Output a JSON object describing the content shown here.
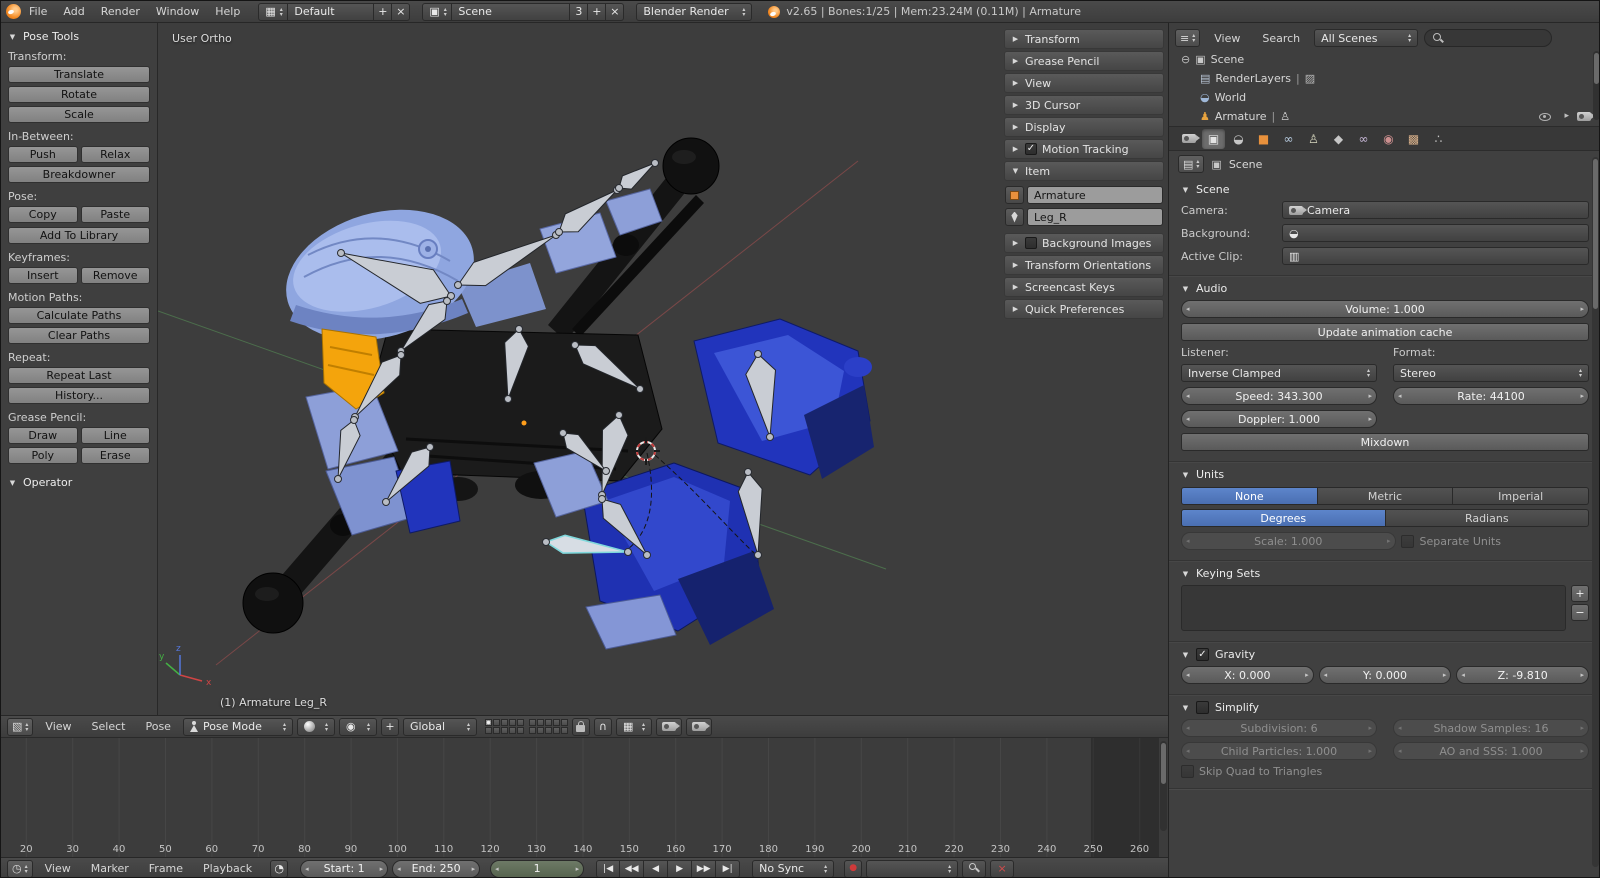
{
  "colors": {
    "accent_blue": "#4a6fb2",
    "object_orange": "#e8913c",
    "bone_select_cyan": "#7fd8dc"
  },
  "top_header": {
    "menus": [
      "File",
      "Add",
      "Render",
      "Window",
      "Help"
    ],
    "layout_name": "Default",
    "scene_name": "Scene",
    "scene_users": "3",
    "engine": "Blender Render",
    "stats": "v2.65 | Bones:1/25 | Mem:23.24M (0.11M) | Armature"
  },
  "tool_shelf": {
    "title": "Pose Tools",
    "operator_title": "Operator",
    "transform_label": "Transform:",
    "translate": "Translate",
    "rotate": "Rotate",
    "scale": "Scale",
    "inbetween_label": "In-Between:",
    "push": "Push",
    "relax": "Relax",
    "breakdowner": "Breakdowner",
    "pose_label": "Pose:",
    "copy": "Copy",
    "paste": "Paste",
    "add_to_library": "Add To Library",
    "keyframes_label": "Keyframes:",
    "insert": "Insert",
    "remove": "Remove",
    "motion_paths_label": "Motion Paths:",
    "calculate_paths": "Calculate Paths",
    "clear_paths": "Clear Paths",
    "repeat_label": "Repeat:",
    "repeat_last": "Repeat Last",
    "history": "History...",
    "grease_label": "Grease Pencil:",
    "draw": "Draw",
    "line": "Line",
    "poly": "Poly",
    "erase": "Erase"
  },
  "viewport": {
    "view_label": "User Ortho",
    "object_label": "(1) Armature Leg_R",
    "npanel": {
      "transform": "Transform",
      "grease_pencil": "Grease Pencil",
      "view": "View",
      "cursor3d": "3D Cursor",
      "display": "Display",
      "motion_tracking": "Motion Tracking",
      "item": "Item",
      "item_object": "Armature",
      "item_bone": "Leg_R",
      "background_images": "Background Images",
      "transform_orientations": "Transform Orientations",
      "screencast_keys": "Screencast Keys",
      "quick_preferences": "Quick Preferences"
    },
    "header": {
      "menus": [
        "View",
        "Select",
        "Pose"
      ],
      "mode": "Pose Mode",
      "orientation": "Global"
    }
  },
  "timeline": {
    "ruler": [
      "20",
      "30",
      "40",
      "50",
      "60",
      "70",
      "80",
      "90",
      "100",
      "110",
      "120",
      "130",
      "140",
      "150",
      "160",
      "170",
      "180",
      "190",
      "200",
      "210",
      "220",
      "230",
      "240",
      "250",
      "260"
    ],
    "header": {
      "menus": [
        "View",
        "Marker",
        "Frame",
        "Playback"
      ],
      "start": "Start: 1",
      "end": "End: 250",
      "frame": "1",
      "sync": "No Sync"
    }
  },
  "outliner": {
    "menus": [
      "View",
      "Search"
    ],
    "scope": "All Scenes",
    "rows": [
      {
        "name": "Scene"
      },
      {
        "name": "RenderLayers"
      },
      {
        "name": "World"
      },
      {
        "name": "Armature"
      }
    ]
  },
  "properties": {
    "context": "Scene",
    "scene": {
      "title": "Scene",
      "camera_label": "Camera:",
      "camera": "Camera",
      "background_label": "Background:",
      "active_clip_label": "Active Clip:"
    },
    "audio": {
      "title": "Audio",
      "volume": "Volume: 1.000",
      "update_cache": "Update animation cache",
      "listener_label": "Listener:",
      "format_label": "Format:",
      "distance_model": "Inverse Clamped",
      "channels": "Stereo",
      "speed": "Speed: 343.300",
      "rate": "Rate: 44100",
      "doppler": "Doppler: 1.000",
      "mixdown": "Mixdown"
    },
    "units": {
      "title": "Units",
      "none": "None",
      "metric": "Metric",
      "imperial": "Imperial",
      "degrees": "Degrees",
      "radians": "Radians",
      "scale": "Scale: 1.000",
      "separate": "Separate Units"
    },
    "keying": {
      "title": "Keying Sets"
    },
    "gravity": {
      "title": "Gravity",
      "x": "X: 0.000",
      "y": "Y: 0.000",
      "z": "Z: -9.810"
    },
    "simplify": {
      "title": "Simplify",
      "subdivision": "Subdivision: 6",
      "shadow": "Shadow Samples: 16",
      "child": "Child Particles: 1.000",
      "ao": "AO and SSS: 1.000",
      "skip_quad": "Skip Quad to Triangles"
    }
  }
}
